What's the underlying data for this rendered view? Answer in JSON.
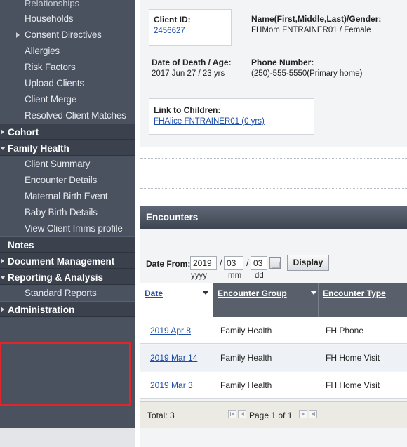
{
  "sidebar": {
    "partial_top_item": "Relationships",
    "client_items": [
      {
        "label": "Households"
      },
      {
        "label": "Consent Directives"
      },
      {
        "label": "Allergies"
      },
      {
        "label": "Risk Factors"
      },
      {
        "label": "Upload Clients"
      },
      {
        "label": "Client Merge"
      },
      {
        "label": "Resolved Client Matches"
      }
    ],
    "cohort": "Cohort",
    "family_health": "Family Health",
    "family_health_items": [
      {
        "label": "Client Summary"
      },
      {
        "label": "Encounter Details"
      },
      {
        "label": "Maternal Birth Event"
      },
      {
        "label": "Baby Birth Details"
      },
      {
        "label": "View Client Imms profile"
      }
    ],
    "notes": "Notes",
    "document_management": "Document Management",
    "reporting_analysis": "Reporting & Analysis",
    "reporting_items": [
      {
        "label": "Standard Reports"
      }
    ],
    "administration": "Administration",
    "highlight_color": "#e0262b"
  },
  "client": {
    "client_id_label": "Client ID:",
    "client_id_value": "2456627",
    "name_label": "Name(First,Middle,Last)/Gender:",
    "name_value": "FHMom FNTRAINER01 / Female",
    "dod_label": "Date of Death / Age:",
    "dod_value": "2017 Jun 27 / 23 yrs",
    "phone_label": "Phone Number:",
    "phone_value": "(250)-555-5550(Primary home)",
    "children_label": "Link to Children:",
    "children_value": "FHAlice FNTRAINER01 (0 yrs)"
  },
  "encounters": {
    "title": "Encounters",
    "date_from_label": "Date From:",
    "year_value": "2019",
    "month_value": "03",
    "day_value": "03",
    "year_hint": "yyyy",
    "month_hint": "mm",
    "day_hint": "dd",
    "display_button": "Display",
    "columns": {
      "date": "Date",
      "group": "Encounter Group",
      "type": "Encounter Type"
    },
    "rows": [
      {
        "date": "2019 Apr 8",
        "group": "Family Health",
        "type": "FH Phone"
      },
      {
        "date": "2019 Mar 14",
        "group": "Family Health",
        "type": "FH Home Visit"
      },
      {
        "date": "2019 Mar 3",
        "group": "Family Health",
        "type": "FH Home Visit"
      }
    ],
    "total": "Total: 3",
    "page_label": "Page 1 of 1"
  }
}
